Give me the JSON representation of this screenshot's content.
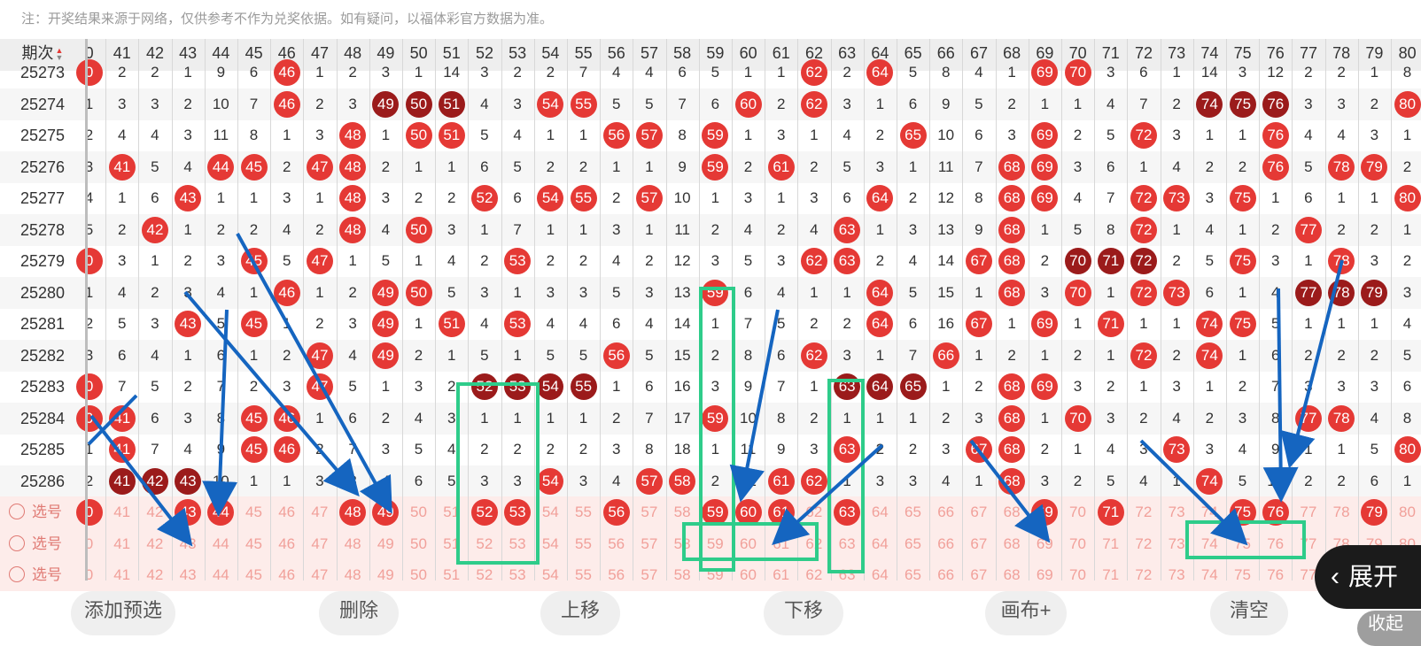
{
  "note": "注：开奖结果来源于网络，仅供参考不作为兑奖依据。如有疑问，以福体彩官方数据为准。",
  "header": {
    "issue_label": "期次",
    "sort_up": "▲",
    "sort_down": "▼",
    "columns": [
      "0",
      "41",
      "42",
      "43",
      "44",
      "45",
      "46",
      "47",
      "48",
      "49",
      "50",
      "51",
      "52",
      "53",
      "54",
      "55",
      "56",
      "57",
      "58",
      "59",
      "60",
      "61",
      "62",
      "63",
      "64",
      "65",
      "66",
      "67",
      "68",
      "69",
      "70",
      "71",
      "72",
      "73",
      "74",
      "75",
      "76",
      "77",
      "78",
      "79",
      "80"
    ]
  },
  "rows": [
    {
      "issue": "25273",
      "cells": [
        [
          "0",
          "r"
        ],
        "2",
        "2",
        "1",
        "9",
        "6",
        [
          "46",
          "r"
        ],
        "1",
        "2",
        "3",
        "1",
        "14",
        "3",
        "2",
        "2",
        "7",
        "4",
        "4",
        "6",
        "5",
        "1",
        "1",
        [
          "62",
          "r"
        ],
        "2",
        [
          "64",
          "r"
        ],
        "5",
        "8",
        "4",
        "1",
        [
          "69",
          "r"
        ],
        [
          "70",
          "r"
        ],
        "3",
        "6",
        "1",
        "14",
        "3",
        "12",
        "2",
        "2",
        "1",
        "8"
      ]
    },
    {
      "issue": "25274",
      "cells": [
        "1",
        "3",
        "3",
        "2",
        "10",
        "7",
        [
          "46",
          "r"
        ],
        "2",
        "3",
        [
          "49",
          "d"
        ],
        [
          "50",
          "d"
        ],
        [
          "51",
          "d"
        ],
        "4",
        "3",
        [
          "54",
          "r"
        ],
        [
          "55",
          "r"
        ],
        "5",
        "5",
        "7",
        "6",
        [
          "60",
          "r"
        ],
        "2",
        [
          "62",
          "r"
        ],
        "3",
        "1",
        "6",
        "9",
        "5",
        "2",
        "1",
        "1",
        "4",
        "7",
        "2",
        [
          "74",
          "d"
        ],
        [
          "75",
          "d"
        ],
        [
          "76",
          "d"
        ],
        "3",
        "3",
        "2",
        [
          "80",
          "r"
        ]
      ]
    },
    {
      "issue": "25275",
      "cells": [
        "2",
        "4",
        "4",
        "3",
        "11",
        "8",
        "1",
        "3",
        [
          "48",
          "r"
        ],
        "1",
        [
          "50",
          "r"
        ],
        [
          "51",
          "r"
        ],
        "5",
        "4",
        "1",
        "1",
        [
          "56",
          "r"
        ],
        [
          "57",
          "r"
        ],
        "8",
        [
          "59",
          "r"
        ],
        "1",
        "3",
        "1",
        "4",
        "2",
        [
          "65",
          "r"
        ],
        "10",
        "6",
        "3",
        [
          "69",
          "r"
        ],
        "2",
        "5",
        [
          "72",
          "r"
        ],
        "3",
        "1",
        "1",
        [
          "76",
          "r"
        ],
        "4",
        "4",
        "3",
        "1"
      ]
    },
    {
      "issue": "25276",
      "cells": [
        "3",
        [
          "41",
          "r"
        ],
        "5",
        "4",
        [
          "44",
          "r"
        ],
        [
          "45",
          "r"
        ],
        "2",
        [
          "47",
          "r"
        ],
        [
          "48",
          "r"
        ],
        "2",
        "1",
        "1",
        "6",
        "5",
        "2",
        "2",
        "1",
        "1",
        "9",
        [
          "59",
          "r"
        ],
        "2",
        [
          "61",
          "r"
        ],
        "2",
        "5",
        "3",
        "1",
        "11",
        "7",
        [
          "68",
          "r"
        ],
        [
          "69",
          "r"
        ],
        "3",
        "6",
        "1",
        "4",
        "2",
        "2",
        [
          "76",
          "r"
        ],
        "5",
        [
          "78",
          "r"
        ],
        [
          "79",
          "r"
        ],
        "2"
      ]
    },
    {
      "issue": "25277",
      "cells": [
        "4",
        "1",
        "6",
        [
          "43",
          "r"
        ],
        "1",
        "1",
        "3",
        "1",
        [
          "48",
          "r"
        ],
        "3",
        "2",
        "2",
        [
          "52",
          "r"
        ],
        "6",
        [
          "54",
          "r"
        ],
        [
          "55",
          "r"
        ],
        "2",
        [
          "57",
          "r"
        ],
        "10",
        "1",
        "3",
        "1",
        "3",
        "6",
        [
          "64",
          "r"
        ],
        "2",
        "12",
        "8",
        [
          "68",
          "r"
        ],
        [
          "69",
          "r"
        ],
        "4",
        "7",
        [
          "72",
          "r"
        ],
        [
          "73",
          "r"
        ],
        "3",
        [
          "75",
          "r"
        ],
        "1",
        "6",
        "1",
        "1",
        [
          "80",
          "r"
        ]
      ]
    },
    {
      "issue": "25278",
      "cells": [
        "5",
        "2",
        [
          "42",
          "r"
        ],
        "1",
        "2",
        "2",
        "4",
        "2",
        [
          "48",
          "r"
        ],
        "4",
        [
          "50",
          "r"
        ],
        "3",
        "1",
        "7",
        "1",
        "1",
        "3",
        "1",
        "11",
        "2",
        "4",
        "2",
        "4",
        [
          "63",
          "r"
        ],
        "1",
        "3",
        "13",
        "9",
        [
          "68",
          "r"
        ],
        "1",
        "5",
        "8",
        [
          "72",
          "r"
        ],
        "1",
        "4",
        "1",
        "2",
        [
          "77",
          "r"
        ],
        "2",
        "2",
        "1"
      ]
    },
    {
      "issue": "25279",
      "cells": [
        [
          "0",
          "r"
        ],
        "3",
        "1",
        "2",
        "3",
        [
          "45",
          "r"
        ],
        "5",
        [
          "47",
          "r"
        ],
        "1",
        "5",
        "1",
        "4",
        "2",
        [
          "53",
          "r"
        ],
        "2",
        "2",
        "4",
        "2",
        "12",
        "3",
        "5",
        "3",
        [
          "62",
          "r"
        ],
        [
          "63",
          "r"
        ],
        "2",
        "4",
        "14",
        [
          "67",
          "r"
        ],
        [
          "68",
          "r"
        ],
        "2",
        [
          "70",
          "d"
        ],
        [
          "71",
          "d"
        ],
        [
          "72",
          "d"
        ],
        "2",
        "5",
        [
          "75",
          "r"
        ],
        "3",
        "1",
        [
          "78",
          "r"
        ],
        "3",
        "2"
      ]
    },
    {
      "issue": "25280",
      "cells": [
        "1",
        "4",
        "2",
        "3",
        "4",
        "1",
        [
          "46",
          "r"
        ],
        "1",
        "2",
        [
          "49",
          "r"
        ],
        [
          "50",
          "r"
        ],
        "5",
        "3",
        "1",
        "3",
        "3",
        "5",
        "3",
        "13",
        [
          "59",
          "r"
        ],
        "6",
        "4",
        "1",
        "1",
        [
          "64",
          "r"
        ],
        "5",
        "15",
        "1",
        [
          "68",
          "r"
        ],
        "3",
        [
          "70",
          "r"
        ],
        "1",
        [
          "72",
          "r"
        ],
        [
          "73",
          "r"
        ],
        "6",
        "1",
        "4",
        [
          "77",
          "d"
        ],
        [
          "78",
          "d"
        ],
        [
          "79",
          "d"
        ],
        "3"
      ]
    },
    {
      "issue": "25281",
      "cells": [
        "2",
        "5",
        "3",
        [
          "43",
          "r"
        ],
        "5",
        [
          "45",
          "r"
        ],
        "1",
        "2",
        "3",
        [
          "49",
          "r"
        ],
        "1",
        [
          "51",
          "r"
        ],
        "4",
        [
          "53",
          "r"
        ],
        "4",
        "4",
        "6",
        "4",
        "14",
        "1",
        "7",
        "5",
        "2",
        "2",
        [
          "64",
          "r"
        ],
        "6",
        "16",
        [
          "67",
          "r"
        ],
        "1",
        [
          "69",
          "r"
        ],
        "1",
        [
          "71",
          "r"
        ],
        "1",
        "1",
        [
          "74",
          "r"
        ],
        [
          "75",
          "r"
        ],
        "5",
        "1",
        "1",
        "1",
        "4"
      ]
    },
    {
      "issue": "25282",
      "cells": [
        "3",
        "6",
        "4",
        "1",
        "6",
        "1",
        "2",
        [
          "47",
          "r"
        ],
        "4",
        [
          "49",
          "r"
        ],
        "2",
        "1",
        "5",
        "1",
        "5",
        "5",
        [
          "56",
          "r"
        ],
        "5",
        "15",
        "2",
        "8",
        "6",
        [
          "62",
          "r"
        ],
        "3",
        "1",
        "7",
        [
          "66",
          "r"
        ],
        "1",
        "2",
        "1",
        "2",
        "1",
        [
          "72",
          "r"
        ],
        "2",
        [
          "74",
          "r"
        ],
        "1",
        "6",
        "2",
        "2",
        "2",
        "5"
      ]
    },
    {
      "issue": "25283",
      "cells": [
        [
          "0",
          "r"
        ],
        "7",
        "5",
        "2",
        "7",
        "2",
        "3",
        [
          "47",
          "r"
        ],
        "5",
        "1",
        "3",
        "2",
        [
          "52",
          "d"
        ],
        [
          "53",
          "d"
        ],
        [
          "54",
          "d"
        ],
        [
          "55",
          "d"
        ],
        "1",
        "6",
        "16",
        "3",
        "9",
        "7",
        "1",
        [
          "63",
          "d"
        ],
        [
          "64",
          "d"
        ],
        [
          "65",
          "d"
        ],
        "1",
        "2",
        [
          "68",
          "r"
        ],
        [
          "69",
          "r"
        ],
        "3",
        "2",
        "1",
        "3",
        "1",
        "2",
        "7",
        "3",
        "3",
        "3",
        "6"
      ]
    },
    {
      "issue": "25284",
      "cells": [
        [
          "0",
          "r"
        ],
        [
          "41",
          "r"
        ],
        "6",
        "3",
        "8",
        [
          "45",
          "r"
        ],
        [
          "46",
          "r"
        ],
        "1",
        "6",
        "2",
        "4",
        "3",
        "1",
        "1",
        "1",
        "1",
        "2",
        "7",
        "17",
        [
          "59",
          "r"
        ],
        "10",
        "8",
        "2",
        "1",
        "1",
        "1",
        "2",
        "3",
        [
          "68",
          "r"
        ],
        "1",
        [
          "70",
          "r"
        ],
        "3",
        "2",
        "4",
        "2",
        "3",
        "8",
        [
          "77",
          "r"
        ],
        [
          "78",
          "r"
        ],
        "4",
        "8"
      ]
    },
    {
      "issue": "25285",
      "cells": [
        "1",
        [
          "41",
          "r"
        ],
        "7",
        "4",
        "9",
        [
          "45",
          "r"
        ],
        [
          "46",
          "r"
        ],
        "2",
        "7",
        "3",
        "5",
        "4",
        "2",
        "2",
        "2",
        "2",
        "3",
        "8",
        "18",
        "1",
        "11",
        "9",
        "3",
        [
          "63",
          "r"
        ],
        "2",
        "2",
        "3",
        [
          "67",
          "r"
        ],
        [
          "68",
          "r"
        ],
        "2",
        "1",
        "4",
        "3",
        [
          "73",
          "r"
        ],
        "3",
        "4",
        "9",
        "1",
        "1",
        "5",
        [
          "80",
          "r"
        ]
      ]
    },
    {
      "issue": "25286",
      "cells": [
        "2",
        [
          "41",
          "d"
        ],
        [
          "42",
          "d"
        ],
        [
          "43",
          "d"
        ],
        "10",
        "1",
        "1",
        "3",
        "8",
        "4",
        "6",
        "5",
        "3",
        "3",
        [
          "54",
          "r"
        ],
        "3",
        "4",
        [
          "57",
          "r"
        ],
        [
          "58",
          "r"
        ],
        "2",
        "12",
        [
          "61",
          "r"
        ],
        [
          "62",
          "r"
        ],
        "1",
        "3",
        "3",
        "4",
        "1",
        [
          "68",
          "r"
        ],
        "3",
        "2",
        "5",
        "4",
        "1",
        [
          "74",
          "r"
        ],
        "5",
        "10",
        "2",
        "2",
        "6",
        "1"
      ]
    }
  ],
  "pick_rows": [
    {
      "label": "选号",
      "selected": [
        "0",
        "43",
        "44",
        "48",
        "49",
        "52",
        "53",
        "56",
        "59",
        "60",
        "61",
        "63",
        "69",
        "71",
        "75",
        "76",
        "79"
      ]
    },
    {
      "label": "选号",
      "selected": []
    },
    {
      "label": "选号",
      "selected": []
    }
  ],
  "buttons": [
    {
      "name": "add-preselect-button",
      "label": "添加预选"
    },
    {
      "name": "delete-button",
      "label": "删除"
    },
    {
      "name": "move-up-button",
      "label": "上移"
    },
    {
      "name": "move-down-button",
      "label": "下移"
    },
    {
      "name": "draw-button",
      "label": "画布+"
    },
    {
      "name": "clear-button",
      "label": "清空"
    }
  ],
  "expand_label": "展开",
  "collapse_label": "收起",
  "colors": {
    "red_ball": "#e53935",
    "dark_ball": "#9b1b1b",
    "annotation_arrow": "#1565c0",
    "annotation_box": "#2ecc8a"
  }
}
